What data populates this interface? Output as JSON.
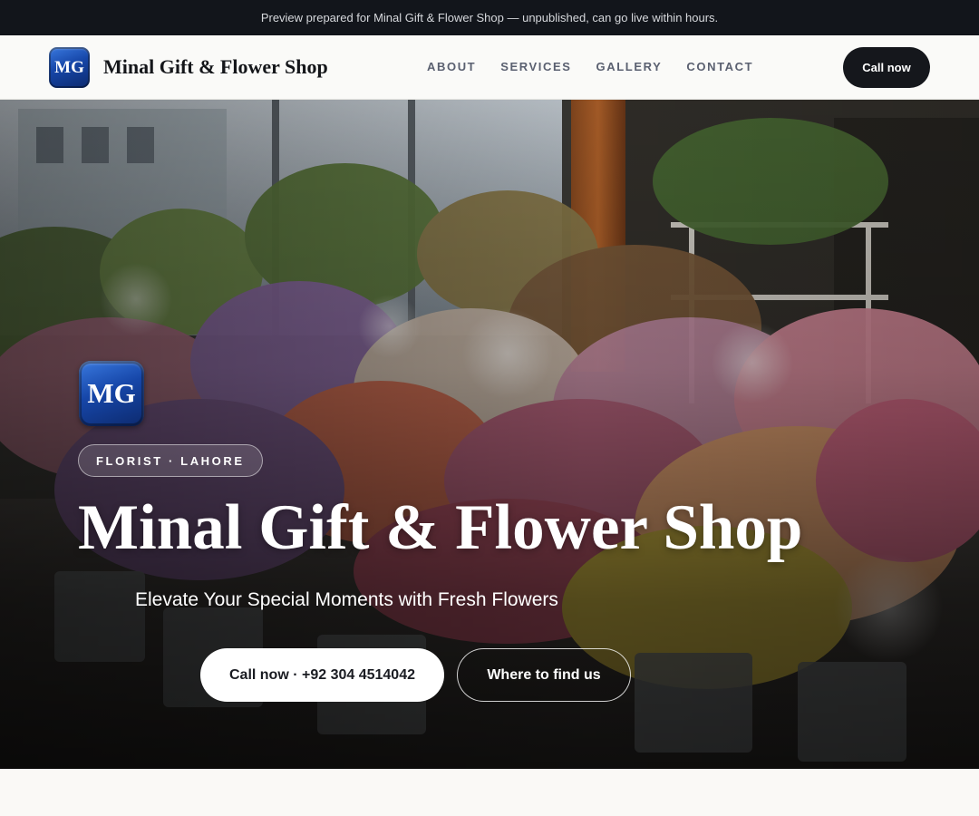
{
  "preview_notice": "Preview prepared for Minal Gift & Flower Shop — unpublished, can go live within hours.",
  "header": {
    "logo_text": "MG",
    "brand_name": "Minal Gift & Flower Shop",
    "nav": [
      {
        "label": "ABOUT"
      },
      {
        "label": "SERVICES"
      },
      {
        "label": "GALLERY"
      },
      {
        "label": "CONTACT"
      }
    ],
    "cta_label": "Call now"
  },
  "hero": {
    "logo_text": "MG",
    "eyebrow": "FLORIST · LAHORE",
    "title": "Minal Gift & Flower Shop",
    "tagline": "Elevate Your Special Moments with Fresh Flowers",
    "primary_cta": "Call now · +92 304 4514042",
    "secondary_cta": "Where to find us",
    "background_image": "flower-shop-interior"
  },
  "colors": {
    "top_bar": "#12151b",
    "brand_blue": "#1646a8",
    "dark_button": "#15171c",
    "page_background": "#faf9f6"
  }
}
